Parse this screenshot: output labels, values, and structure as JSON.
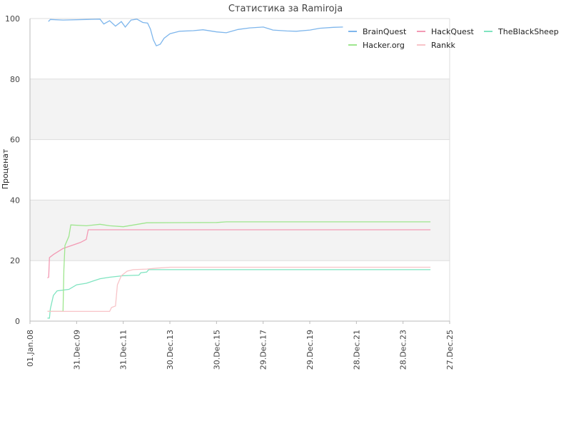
{
  "chart_data": {
    "type": "line",
    "title": "Статистика за Ramiroja",
    "xlabel": "",
    "ylabel": "Проценат",
    "ylim": [
      0,
      100
    ],
    "xlim": [
      "2008-01-01",
      "2025-12-27"
    ],
    "yticks": [
      0,
      20,
      40,
      60,
      80,
      100
    ],
    "xticks": [
      {
        "label": "01.Jan.08",
        "date": "2008-01-01"
      },
      {
        "label": "31.Dec.09",
        "date": "2009-12-31"
      },
      {
        "label": "31.Dec.11",
        "date": "2011-12-31"
      },
      {
        "label": "30.Dec.13",
        "date": "2013-12-30"
      },
      {
        "label": "30.Dec.15",
        "date": "2015-12-30"
      },
      {
        "label": "29.Dec.17",
        "date": "2017-12-29"
      },
      {
        "label": "29.Dec.19",
        "date": "2019-12-29"
      },
      {
        "label": "28.Dec.21",
        "date": "2021-12-28"
      },
      {
        "label": "28.Dec.23",
        "date": "2023-12-28"
      },
      {
        "label": "27.Dec.25",
        "date": "2025-12-27"
      }
    ],
    "grid": true,
    "legend_position": "top-right",
    "series": [
      {
        "name": "BrainQuest",
        "color": "#7eb6ec",
        "points": [
          [
            "2008-10-15",
            99.0
          ],
          [
            "2008-11-15",
            99.7
          ],
          [
            "2009-06-01",
            99.5
          ],
          [
            "2010-06-01",
            99.7
          ],
          [
            "2011-01-01",
            99.8
          ],
          [
            "2011-03-01",
            98.2
          ],
          [
            "2011-06-01",
            99.3
          ],
          [
            "2011-09-01",
            97.5
          ],
          [
            "2011-12-01",
            99.0
          ],
          [
            "2012-02-01",
            97.2
          ],
          [
            "2012-05-01",
            99.5
          ],
          [
            "2012-08-01",
            99.8
          ],
          [
            "2012-11-01",
            98.7
          ],
          [
            "2013-01-15",
            98.5
          ],
          [
            "2013-03-01",
            96.5
          ],
          [
            "2013-04-15",
            93.0
          ],
          [
            "2013-06-01",
            91.0
          ],
          [
            "2013-08-01",
            91.5
          ],
          [
            "2013-10-01",
            93.5
          ],
          [
            "2014-01-01",
            95.0
          ],
          [
            "2014-06-01",
            95.8
          ],
          [
            "2015-01-01",
            96.0
          ],
          [
            "2015-06-01",
            96.3
          ],
          [
            "2016-01-01",
            95.6
          ],
          [
            "2016-06-01",
            95.3
          ],
          [
            "2016-12-01",
            96.4
          ],
          [
            "2017-06-01",
            96.9
          ],
          [
            "2018-01-01",
            97.2
          ],
          [
            "2018-06-01",
            96.2
          ],
          [
            "2019-01-01",
            95.9
          ],
          [
            "2019-06-01",
            95.8
          ],
          [
            "2020-01-01",
            96.2
          ],
          [
            "2020-06-01",
            96.8
          ],
          [
            "2021-01-01",
            97.1
          ],
          [
            "2021-06-01",
            97.2
          ]
        ]
      },
      {
        "name": "HackQuest",
        "color": "#f39ab4",
        "points": [
          [
            "2008-10-01",
            14.3
          ],
          [
            "2008-10-20",
            14.5
          ],
          [
            "2008-11-01",
            21.0
          ],
          [
            "2009-01-01",
            22.0
          ],
          [
            "2009-06-01",
            24.0
          ],
          [
            "2010-03-01",
            26.0
          ],
          [
            "2010-06-01",
            27.0
          ],
          [
            "2010-07-01",
            30.2
          ],
          [
            "2012-01-01",
            30.2
          ],
          [
            "2016-01-01",
            30.2
          ],
          [
            "2020-01-01",
            30.2
          ],
          [
            "2025-03-01",
            30.2
          ]
        ]
      },
      {
        "name": "TheBlackSheep",
        "color": "#7fe4c0",
        "points": [
          [
            "2008-10-01",
            1.0
          ],
          [
            "2008-11-01",
            1.0
          ],
          [
            "2008-11-15",
            4.0
          ],
          [
            "2009-01-01",
            8.5
          ],
          [
            "2009-03-01",
            10.0
          ],
          [
            "2009-09-01",
            10.5
          ],
          [
            "2010-01-01",
            12.0
          ],
          [
            "2010-06-01",
            12.5
          ],
          [
            "2011-01-01",
            14.0
          ],
          [
            "2011-06-01",
            14.5
          ],
          [
            "2012-01-01",
            15.0
          ],
          [
            "2012-09-01",
            15.2
          ],
          [
            "2012-10-01",
            16.0
          ],
          [
            "2013-01-01",
            16.2
          ],
          [
            "2013-02-01",
            17.0
          ],
          [
            "2016-01-01",
            17.0
          ],
          [
            "2020-01-01",
            17.0
          ],
          [
            "2025-03-01",
            17.0
          ]
        ]
      },
      {
        "name": "Hacker.org",
        "color": "#9ee68e",
        "points": [
          [
            "2008-10-01",
            3.2
          ],
          [
            "2009-06-01",
            3.2
          ],
          [
            "2009-06-15",
            17.0
          ],
          [
            "2009-07-01",
            25.0
          ],
          [
            "2009-09-01",
            28.0
          ],
          [
            "2009-10-01",
            31.8
          ],
          [
            "2010-06-01",
            31.5
          ],
          [
            "2011-01-01",
            32.0
          ],
          [
            "2011-06-01",
            31.5
          ],
          [
            "2012-01-01",
            31.2
          ],
          [
            "2013-01-01",
            32.5
          ],
          [
            "2016-01-01",
            32.6
          ],
          [
            "2016-06-01",
            32.8
          ],
          [
            "2020-01-01",
            32.8
          ],
          [
            "2025-03-01",
            32.8
          ]
        ]
      },
      {
        "name": "Rankk",
        "color": "#f8c4c8",
        "points": [
          [
            "2008-10-01",
            3.2
          ],
          [
            "2011-06-01",
            3.2
          ],
          [
            "2011-07-01",
            4.5
          ],
          [
            "2011-09-01",
            5.0
          ],
          [
            "2011-10-01",
            12.0
          ],
          [
            "2011-12-01",
            15.0
          ],
          [
            "2012-03-01",
            16.5
          ],
          [
            "2012-06-01",
            17.0
          ],
          [
            "2013-01-01",
            17.2
          ],
          [
            "2013-06-01",
            17.5
          ],
          [
            "2014-01-01",
            17.8
          ],
          [
            "2016-01-01",
            17.8
          ],
          [
            "2020-01-01",
            17.8
          ],
          [
            "2025-03-01",
            17.8
          ]
        ]
      }
    ]
  }
}
